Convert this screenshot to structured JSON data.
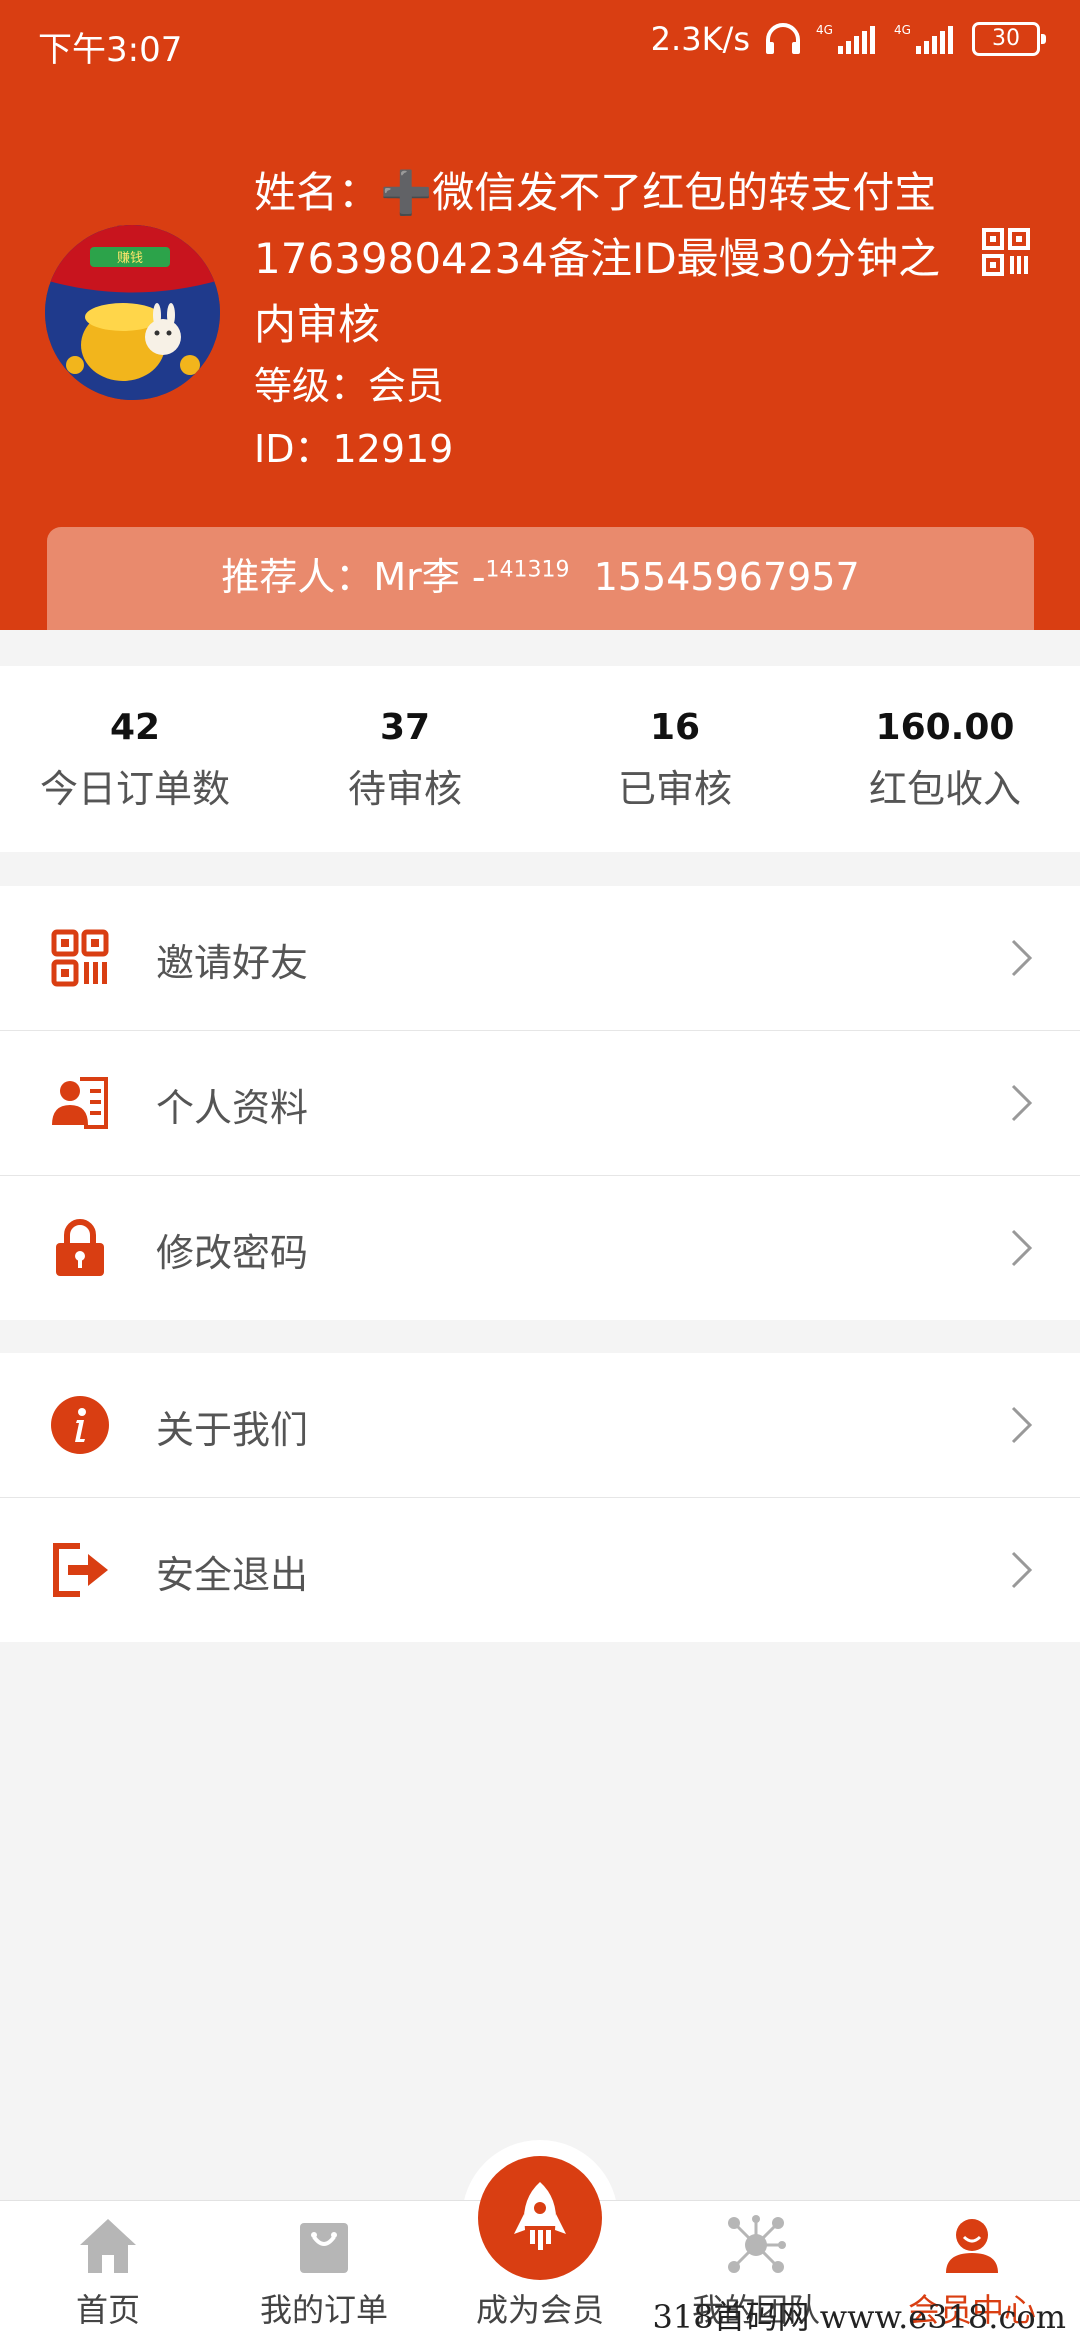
{
  "status_bar": {
    "time": "下午3:07",
    "speed": "2.3K/s",
    "battery": "30"
  },
  "profile": {
    "name": "姓名：➕微信发不了红包的转支付宝17639804234备注ID最慢30分钟之内审核",
    "level": "等级：会员",
    "id": "ID：12919",
    "avatar_badge": "赚钱",
    "referrer_prefix": "推荐人：Mr李 -",
    "referrer_sup": "141319",
    "referrer_phone": "15545967957"
  },
  "stats": [
    {
      "value": "42",
      "label": "今日订单数"
    },
    {
      "value": "37",
      "label": "待审核"
    },
    {
      "value": "16",
      "label": "已审核"
    },
    {
      "value": "160.00",
      "label": "红包收入"
    }
  ],
  "menu_group_1": [
    {
      "label": "邀请好友",
      "icon": "qr-code-icon"
    },
    {
      "label": "个人资料",
      "icon": "profile-card-icon"
    },
    {
      "label": "修改密码",
      "icon": "lock-icon"
    }
  ],
  "menu_group_2": [
    {
      "label": "关于我们",
      "icon": "info-icon"
    },
    {
      "label": "安全退出",
      "icon": "logout-icon"
    }
  ],
  "tabbar": [
    {
      "label": "首页",
      "icon": "home-icon"
    },
    {
      "label": "我的订单",
      "icon": "shopping-bag-icon"
    },
    {
      "label": "成为会员",
      "icon": "rocket-icon"
    },
    {
      "label": "我的团队",
      "icon": "network-icon"
    },
    {
      "label": "会员中心",
      "icon": "user-icon"
    }
  ],
  "watermark": "318首码网   www.e318.com",
  "colors": {
    "accent": "#d93e12",
    "referrer_bg": "#e98a6d"
  }
}
